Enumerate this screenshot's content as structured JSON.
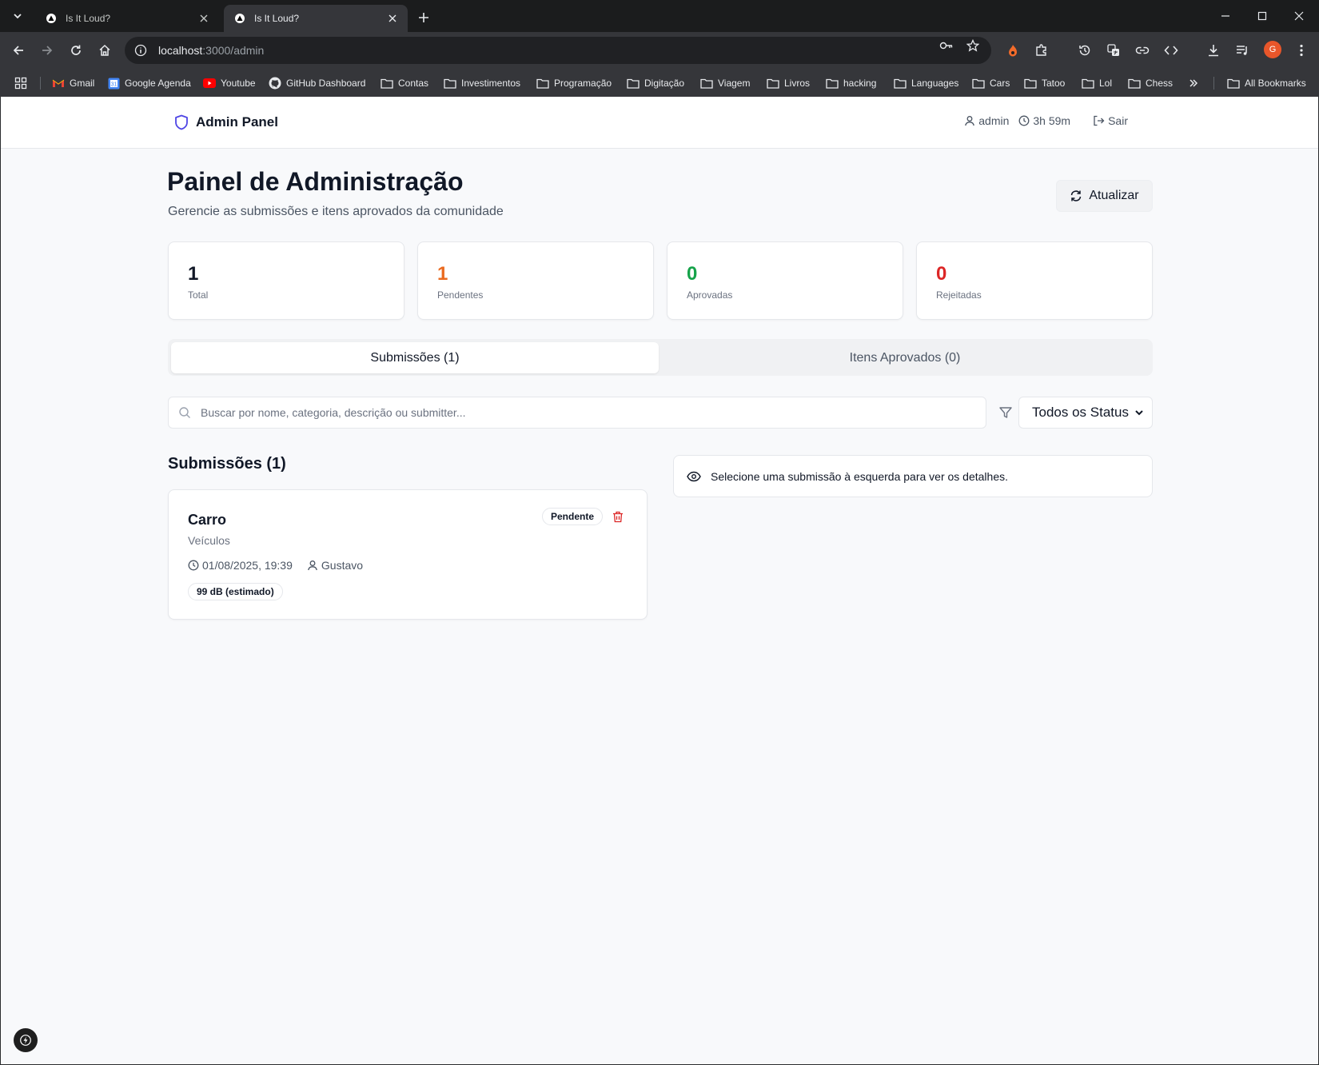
{
  "browser": {
    "tabs": [
      {
        "title": "Is It Loud?",
        "active": false
      },
      {
        "title": "Is It Loud?",
        "active": true
      }
    ],
    "url_host": "localhost",
    "url_path": ":3000/admin",
    "profile_initial": "G",
    "bookmarks": [
      {
        "label": "Gmail",
        "icon": "gmail-icon"
      },
      {
        "label": "Google Agenda",
        "icon": "calendar-icon"
      },
      {
        "label": "Youtube",
        "icon": "youtube-icon"
      },
      {
        "label": "GitHub Dashboard",
        "icon": "github-icon"
      },
      {
        "label": "Contas",
        "icon": "folder-icon"
      },
      {
        "label": "Investimentos",
        "icon": "folder-icon"
      },
      {
        "label": "Programação",
        "icon": "folder-icon"
      },
      {
        "label": "Digitação",
        "icon": "folder-icon"
      },
      {
        "label": "Viagem",
        "icon": "folder-icon"
      },
      {
        "label": "Livros",
        "icon": "folder-icon"
      },
      {
        "label": "hacking",
        "icon": "folder-icon"
      },
      {
        "label": "Languages",
        "icon": "folder-icon"
      },
      {
        "label": "Cars",
        "icon": "folder-icon"
      },
      {
        "label": "Tatoo",
        "icon": "folder-icon"
      },
      {
        "label": "Lol",
        "icon": "folder-icon"
      },
      {
        "label": "Chess",
        "icon": "folder-icon"
      }
    ],
    "all_bookmarks": "All Bookmarks"
  },
  "header": {
    "brand": "Admin Panel",
    "user": "admin",
    "session": "3h 59m",
    "logout": "Sair"
  },
  "page": {
    "title": "Painel de Administração",
    "subtitle": "Gerencie as submissões e itens aprovados da comunidade",
    "refresh": "Atualizar"
  },
  "stats": [
    {
      "value": "1",
      "label": "Total",
      "color": "#111827"
    },
    {
      "value": "1",
      "label": "Pendentes",
      "color": "#ea6a1f"
    },
    {
      "value": "0",
      "label": "Aprovadas",
      "color": "#16a34a"
    },
    {
      "value": "0",
      "label": "Rejeitadas",
      "color": "#dc2626"
    }
  ],
  "tabs": {
    "submissions": "Submissões (1)",
    "approved": "Itens Aprovados (0)",
    "active": "submissions"
  },
  "filters": {
    "search_placeholder": "Buscar por nome, categoria, descrição ou submitter...",
    "search_value": "",
    "status_selected": "Todos os Status"
  },
  "submissions": {
    "heading": "Submissões (1)",
    "items": [
      {
        "name": "Carro",
        "category": "Veículos",
        "date": "01/08/2025, 19:39",
        "submitter": "Gustavo",
        "db": "99 dB (estimado)",
        "status": "Pendente"
      }
    ]
  },
  "detail": {
    "empty_text": "Selecione uma submissão à esquerda para ver os detalhes."
  }
}
